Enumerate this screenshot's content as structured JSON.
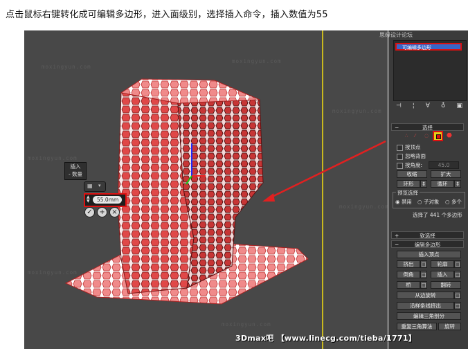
{
  "caption": "点击鼠标右键转化成可编辑多边形，进入面级别，选择插入命令，插入数值为55",
  "watermark": "moxingyun.com",
  "top_banner": "思缘设计论坛",
  "popup": {
    "title_line1": "插入",
    "title_line2": "- 数量",
    "value": "55.0mm"
  },
  "stack": {
    "item": "可编辑多边形"
  },
  "select_rollout": {
    "title": "选择",
    "by_vertex": "按顶点",
    "ignore_backface": "忽略背面",
    "by_angle": "按角度:",
    "angle_value": "45.0",
    "shrink": "收缩",
    "grow": "扩大",
    "ring": "环形",
    "loop": "循环",
    "preview_label": "预览选择",
    "disable": "禁用",
    "sub_object": "子对象",
    "multi": "多个",
    "status": "选择了 441 个多边形"
  },
  "soft_select": {
    "title": "软选择"
  },
  "edit_poly": {
    "title": "编辑多边形",
    "insert_vertex": "插入顶点",
    "extrude": "挤出",
    "outline": "轮廓",
    "bevel": "倒角",
    "inset": "插入",
    "bridge": "桥",
    "flip": "翻转",
    "hinge": "从边旋转",
    "extrude_spline": "沿样条线挤出",
    "edit_tri": "编辑三角剖分",
    "retriangulate": "重复三角算法",
    "turn": "旋转"
  },
  "footer": "3Dmax吧 【www.linecg.com/tieba/1771】",
  "colors": {
    "viewport": "#484848",
    "mesh": "#e04848",
    "highlight": "#d91111",
    "stack_select": "#3865c8"
  }
}
